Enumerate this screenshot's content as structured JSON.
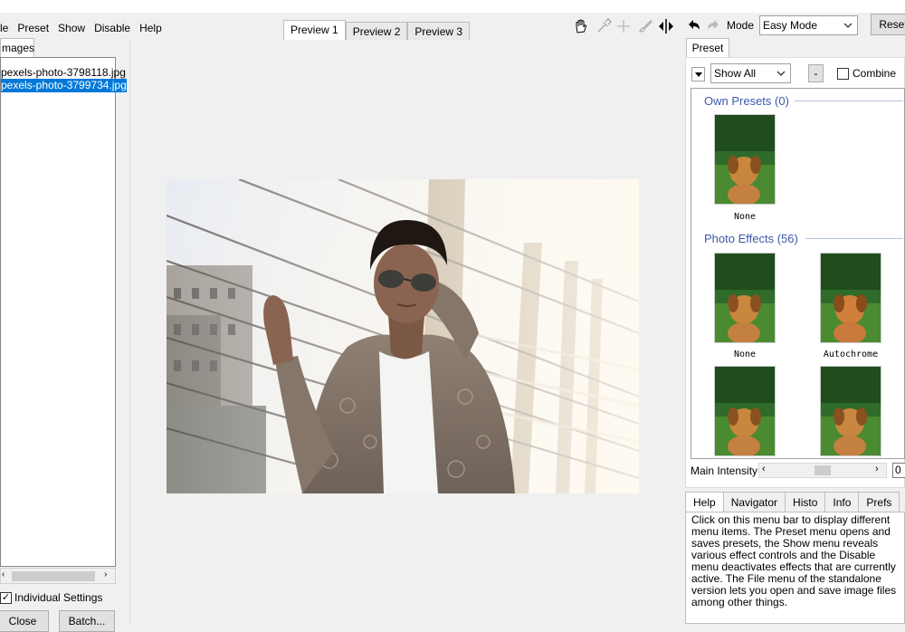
{
  "menu": [
    "le",
    "Preset",
    "Show",
    "Disable",
    "Help"
  ],
  "preview_tabs": [
    {
      "label": "Preview 1",
      "active": true
    },
    {
      "label": "Preview 2",
      "active": false
    },
    {
      "label": "Preview 3",
      "active": false
    }
  ],
  "toolbar": {
    "tools": [
      "hand-icon",
      "eyedropper-icon",
      "crosshair-icon",
      "brush-icon",
      "split-arrows-icon"
    ],
    "undo_icon": "undo-icon",
    "redo_icon": "redo-icon",
    "mode_label": "Mode",
    "mode_value": "Easy Mode",
    "reset_label": "Reset"
  },
  "left": {
    "tab_label": "mages",
    "files": [
      {
        "name": "pexels-photo-3798118.jpg",
        "selected": false
      },
      {
        "name": "pexels-photo-3799734.jpg",
        "selected": true
      }
    ],
    "individual_settings_label": "Individual Settings",
    "individual_settings_checked": true,
    "close_label": "Close",
    "batch_label": "Batch..."
  },
  "right": {
    "tab_label": "Preset",
    "filter_value": "Show All",
    "minus_label": "-",
    "combine_label": "Combine",
    "combine_checked": false,
    "sections": [
      {
        "title": "Own Presets (0)",
        "items": [
          "None"
        ]
      },
      {
        "title": "Photo Effects (56)",
        "items": [
          "None",
          "Autochrome",
          "",
          ""
        ]
      }
    ],
    "intensity_label": "Main Intensity",
    "intensity_value": "0"
  },
  "bottom_tabs": [
    {
      "label": "Help",
      "active": true
    },
    {
      "label": "Navigator",
      "active": false
    },
    {
      "label": "Histo",
      "active": false
    },
    {
      "label": "Info",
      "active": false
    },
    {
      "label": "Prefs",
      "active": false
    }
  ],
  "help_text": "Click on this menu bar to display different menu items. The Preset menu opens and saves presets, the Show menu reveals various effect controls and the Disable menu deactivates effects that are currently active. The File menu of the standalone version lets you open and save image files among other things.",
  "colors": {
    "selection": "#0078d7",
    "section_title": "#3c5aa8",
    "panel_bg": "#f0f0f0"
  }
}
